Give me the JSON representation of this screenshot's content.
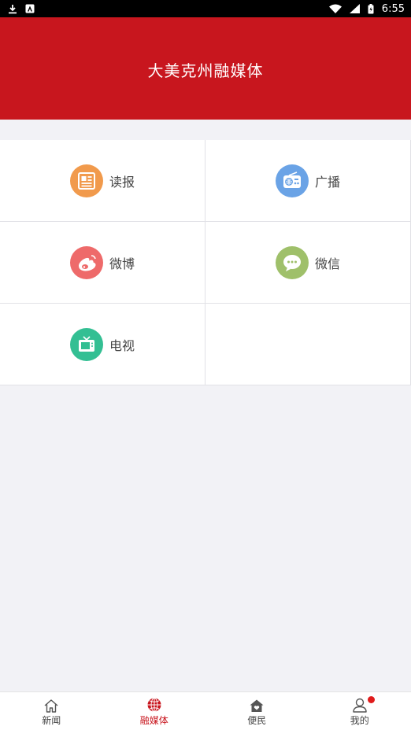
{
  "status_bar": {
    "time": "6:55"
  },
  "header": {
    "title": "大美克州融媒体"
  },
  "grid": {
    "items": [
      {
        "label": "读报",
        "icon": "newspaper-icon",
        "color": "#f19a4c"
      },
      {
        "label": "广播",
        "icon": "radio-icon",
        "color": "#6aa3e6"
      },
      {
        "label": "微博",
        "icon": "weibo-icon",
        "color": "#ee6a6a"
      },
      {
        "label": "微信",
        "icon": "wechat-icon",
        "color": "#9fc06a"
      },
      {
        "label": "电视",
        "icon": "tv-icon",
        "color": "#33bf93"
      }
    ]
  },
  "tabbar": {
    "tabs": [
      {
        "label": "新闻",
        "icon": "home-icon",
        "active": false
      },
      {
        "label": "融媒体",
        "icon": "globe-icon",
        "active": true
      },
      {
        "label": "便民",
        "icon": "house-heart-icon",
        "active": false
      },
      {
        "label": "我的",
        "icon": "user-icon",
        "active": false,
        "badge": true
      }
    ],
    "active_color": "#c8161e"
  },
  "colors": {
    "brand": "#c8161e",
    "background": "#f2f2f6"
  }
}
